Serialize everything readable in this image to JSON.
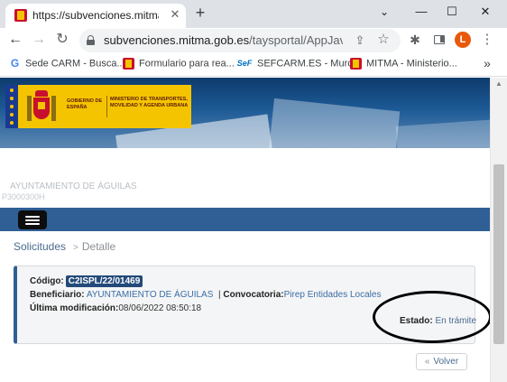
{
  "browser": {
    "tab": {
      "title": "https://subvenciones.mitma.gob.es",
      "close": "✕",
      "icon": "spain-gov-favicon"
    },
    "new_tab": "+",
    "window_controls": {
      "chevron": "⌄",
      "minimize": "—",
      "maximize": "☐",
      "close": "✕"
    },
    "url": {
      "host": "subvenciones.mitma.gob.es",
      "path": "/taysportal/AppJava/ex..."
    },
    "profile_initial": "L",
    "toolbar_icons": [
      "back-arrow-icon",
      "forward-arrow-icon",
      "reload-icon",
      "lock-icon",
      "share-icon",
      "star-icon",
      "extensions-icon",
      "side-panel-icon",
      "kebab-menu-icon"
    ],
    "bookmarks": [
      {
        "icon": "G",
        "label": "Sede CARM - Busca..."
      },
      {
        "icon": "",
        "label": "Formulario para rea..."
      },
      {
        "icon": "SeF",
        "label": "SEFCARM.ES - Murc..."
      },
      {
        "icon": "",
        "label": "MITMA - Ministerio..."
      }
    ],
    "bookmarks_more": "»"
  },
  "site": {
    "logo": {
      "government": "GOBIERNO DE ESPAÑA",
      "ministry": "MINISTERIO DE TRANSPORTES, MOVILIDAD Y AGENDA URBANA"
    },
    "organization": {
      "name": "AYUNTAMIENTO DE ÁGUILAS",
      "nif": "P3000300H"
    },
    "breadcrumb": {
      "root": "Solicitudes",
      "separator": ">",
      "current": "Detalle"
    },
    "detail": {
      "code_label": "Código:",
      "code_value": "C2ISPL/22/01469",
      "beneficiary_label": "Beneficiario:",
      "beneficiary_value": "AYUNTAMIENTO DE ÁGUILAS",
      "divider": "|",
      "call_label": "Convocatoria:",
      "call_value": "Pirep Entidades Locales",
      "modified_label": "Última modificación:",
      "modified_value": "08/06/2022 08:50:18",
      "state_label": "Estado:",
      "state_value": "En trámite"
    },
    "back_button": {
      "chevron": "«",
      "label": "Volver"
    },
    "colors": {
      "navbar": "#2f5f95",
      "code_badge": "#234a7a",
      "logo_yellow": "#f5c400",
      "annotation": "#000000"
    }
  }
}
